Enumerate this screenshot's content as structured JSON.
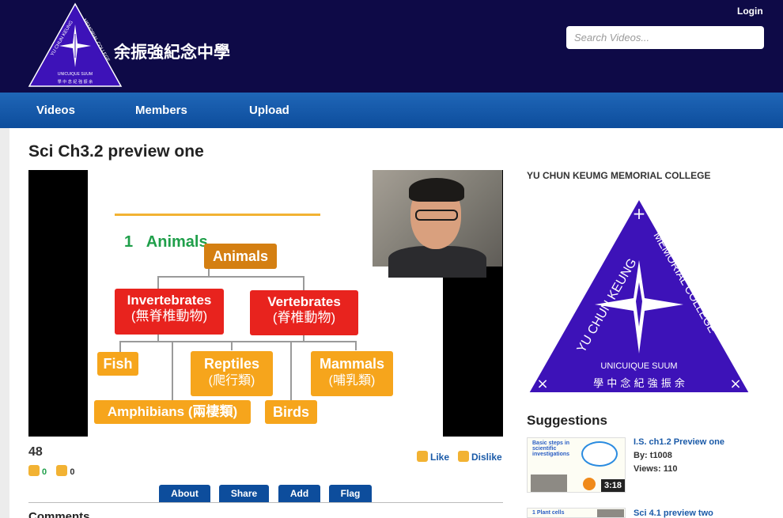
{
  "header": {
    "school_name": "余振強紀念中學",
    "login_label": "Login",
    "search_placeholder": "Search Videos..."
  },
  "logo": {
    "top_text": "YU CHUN KEUNG MEMORIAL COLLEGE",
    "motto": "UNICUIQUE SUUM",
    "chinese": "學 中 念 紀 強 振 余"
  },
  "nav": {
    "items": [
      "Videos",
      "Members",
      "Upload"
    ]
  },
  "video": {
    "title": "Sci Ch3.2 preview one",
    "slide": {
      "heading_number": "1",
      "heading": "Animals",
      "root": "Animals",
      "invertebrates": "Invertebrates",
      "invertebrates_cn": "(無脊椎動物)",
      "vertebrates": "Vertebrates",
      "vertebrates_cn": "(脊椎動物)",
      "fish": "Fish",
      "reptiles": "Reptiles",
      "reptiles_cn": "(爬行類)",
      "mammals": "Mammals",
      "mammals_cn": "(哺乳類)",
      "amphibians": "Amphibians (兩棲類)",
      "birds": "Birds"
    },
    "view_count": "48",
    "likes": "0",
    "dislikes": "0",
    "like_label": "Like",
    "dislike_label": "Dislike",
    "tabs": [
      "About",
      "Share",
      "Add",
      "Flag"
    ],
    "comments_heading": "Comments"
  },
  "sidebar": {
    "title": "YU CHUN KEUMG MEMORIAL COLLEGE",
    "suggestions_title": "Suggestions",
    "suggestions": [
      {
        "title": "I.S. ch1.2 Preview one",
        "by": "By: t1008",
        "views": "Views: 110",
        "duration": "3:18",
        "thumb_text": "Basic steps in scientific investigations"
      },
      {
        "title": "Sci 4.1 preview two",
        "thumb_text": "1 Plant cells"
      }
    ]
  },
  "colors": {
    "header_bg": "#0e0a47",
    "nav_bg": "#1f66b7",
    "logo_purple": "#3d12b8",
    "link_blue": "#1a5aa8",
    "slide_orange": "#f6a51c",
    "slide_red": "#e8231e"
  }
}
